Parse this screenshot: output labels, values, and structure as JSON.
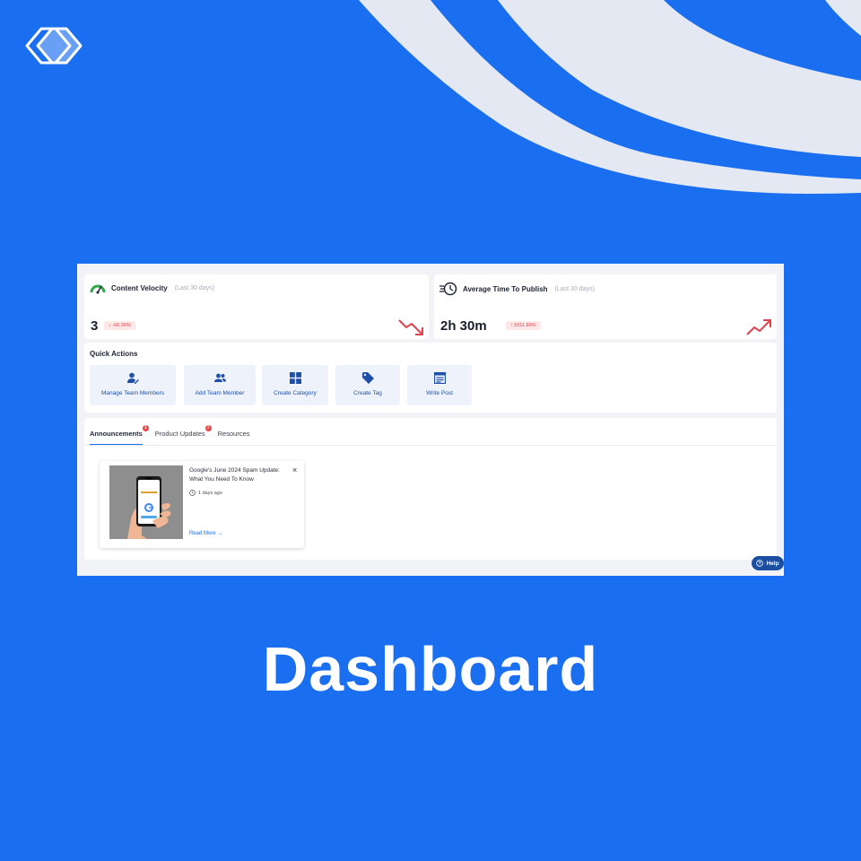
{
  "colors": {
    "background": "#1a6ef0",
    "accent": "#1a6ef0",
    "negative": "#e0434e",
    "button_text": "#1f4fa8"
  },
  "stats": [
    {
      "title": "Content Velocity",
      "period": "(Last 30 days)",
      "value": "3",
      "change": "↓ -66.36%",
      "icon": "speedometer-icon",
      "trend": "trend-down-icon"
    },
    {
      "title": "Average Time To Publish",
      "period": "(Last 30 days)",
      "value": "2h 30m",
      "change": "↑ 5511.89%",
      "icon": "clock-speed-icon",
      "trend": "trend-up-icon"
    }
  ],
  "quick_actions": {
    "title": "Quick Actions",
    "items": [
      {
        "label": "Manage Team Members",
        "icon": "user-edit-icon"
      },
      {
        "label": "Add Team Member",
        "icon": "users-icon"
      },
      {
        "label": "Create Category",
        "icon": "grid-icon"
      },
      {
        "label": "Create Tag",
        "icon": "tag-icon"
      },
      {
        "label": "Write Post",
        "icon": "write-post-icon"
      }
    ]
  },
  "tabs": [
    {
      "label": "Announcements",
      "badge": "1"
    },
    {
      "label": "Product Updates",
      "badge": "3"
    },
    {
      "label": "Resources",
      "badge": ""
    }
  ],
  "announcement": {
    "title": "Google's June 2024 Spam Update: What You Need To Know",
    "time": "1 days ago",
    "read_more": "Read More →"
  },
  "help": {
    "label": "Help"
  },
  "headline": "Dashboard"
}
